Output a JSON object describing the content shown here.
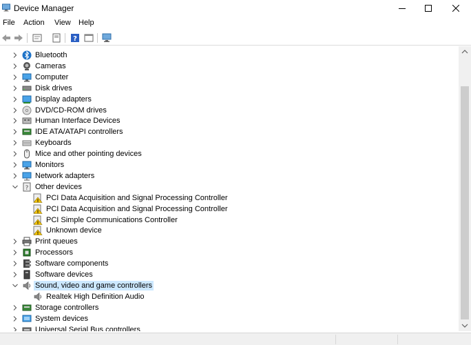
{
  "window": {
    "title": "Device Manager"
  },
  "menu": [
    "File",
    "Action",
    "View",
    "Help"
  ],
  "toolbar": {
    "buttons": [
      "back-icon",
      "forward-icon",
      "properties-icon",
      "update-driver-icon",
      "help-icon",
      "view-icon",
      "monitor-icon"
    ]
  },
  "tree": {
    "items": [
      {
        "label": "Bluetooth",
        "icon": "bluetooth-icon",
        "level": 0,
        "expanded": false
      },
      {
        "label": "Cameras",
        "icon": "camera-icon",
        "level": 0,
        "expanded": false
      },
      {
        "label": "Computer",
        "icon": "computer-icon",
        "level": 0,
        "expanded": false
      },
      {
        "label": "Disk drives",
        "icon": "disk-drive-icon",
        "level": 0,
        "expanded": false
      },
      {
        "label": "Display adapters",
        "icon": "display-adapter-icon",
        "level": 0,
        "expanded": false
      },
      {
        "label": "DVD/CD-ROM drives",
        "icon": "dvd-drive-icon",
        "level": 0,
        "expanded": false
      },
      {
        "label": "Human Interface Devices",
        "icon": "hid-icon",
        "level": 0,
        "expanded": false
      },
      {
        "label": "IDE ATA/ATAPI controllers",
        "icon": "ide-controller-icon",
        "level": 0,
        "expanded": false
      },
      {
        "label": "Keyboards",
        "icon": "keyboard-icon",
        "level": 0,
        "expanded": false
      },
      {
        "label": "Mice and other pointing devices",
        "icon": "mouse-icon",
        "level": 0,
        "expanded": false
      },
      {
        "label": "Monitors",
        "icon": "monitor-icon",
        "level": 0,
        "expanded": false
      },
      {
        "label": "Network adapters",
        "icon": "network-adapter-icon",
        "level": 0,
        "expanded": false
      },
      {
        "label": "Other devices",
        "icon": "other-devices-icon",
        "level": 0,
        "expanded": true
      },
      {
        "label": "PCI Data Acquisition and Signal Processing Controller",
        "icon": "warning-device-icon",
        "level": 1
      },
      {
        "label": "PCI Data Acquisition and Signal Processing Controller",
        "icon": "warning-device-icon",
        "level": 1
      },
      {
        "label": "PCI Simple Communications Controller",
        "icon": "warning-device-icon",
        "level": 1
      },
      {
        "label": "Unknown device",
        "icon": "warning-device-icon",
        "level": 1
      },
      {
        "label": "Print queues",
        "icon": "printer-icon",
        "level": 0,
        "expanded": false
      },
      {
        "label": "Processors",
        "icon": "processor-icon",
        "level": 0,
        "expanded": false
      },
      {
        "label": "Software components",
        "icon": "software-component-icon",
        "level": 0,
        "expanded": false
      },
      {
        "label": "Software devices",
        "icon": "software-device-icon",
        "level": 0,
        "expanded": false
      },
      {
        "label": "Sound, video and game controllers",
        "icon": "speaker-icon",
        "level": 0,
        "expanded": true,
        "selected": true
      },
      {
        "label": "Realtek High Definition Audio",
        "icon": "speaker-icon",
        "level": 1
      },
      {
        "label": "Storage controllers",
        "icon": "storage-controller-icon",
        "level": 0,
        "expanded": false
      },
      {
        "label": "System devices",
        "icon": "system-device-icon",
        "level": 0,
        "expanded": false
      },
      {
        "label": "Universal Serial Bus controllers",
        "icon": "usb-icon",
        "level": 0,
        "expanded": false
      }
    ]
  },
  "colors": {
    "selection": "#cce8ff",
    "accent": "#1e73c8",
    "warning": "#f2c200"
  }
}
